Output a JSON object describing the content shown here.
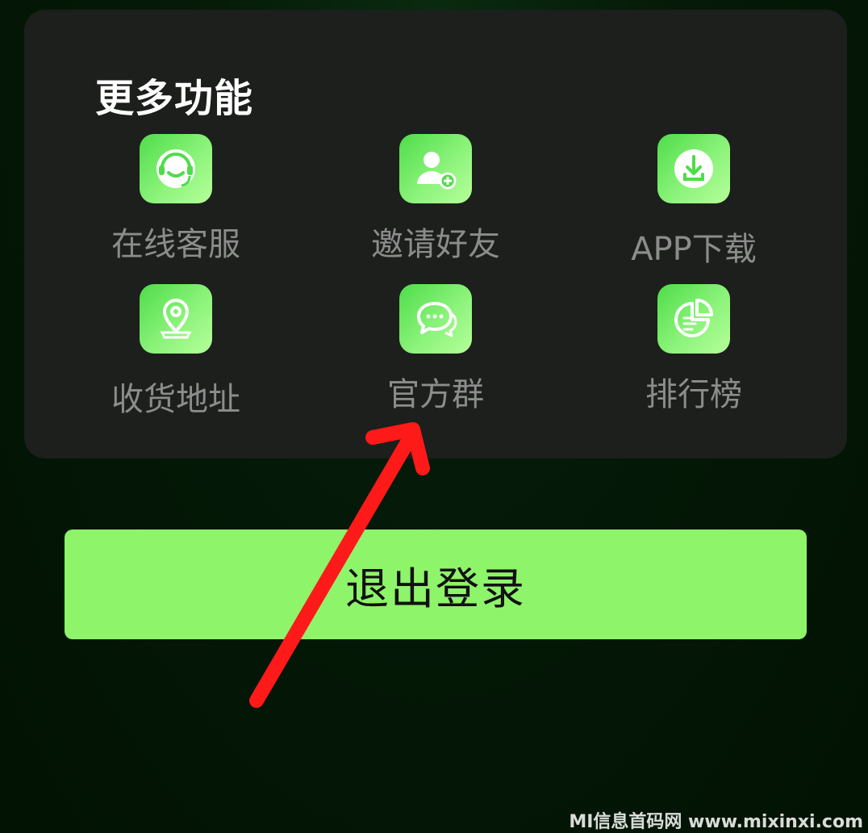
{
  "panel": {
    "title": "更多功能",
    "items": [
      {
        "label": "在线客服",
        "icon": "customer-service-icon"
      },
      {
        "label": "邀请好友",
        "icon": "invite-friend-icon"
      },
      {
        "label": "APP下载",
        "icon": "download-icon"
      },
      {
        "label": "收货地址",
        "icon": "location-pin-icon"
      },
      {
        "label": "官方群",
        "icon": "chat-bubbles-icon"
      },
      {
        "label": "排行榜",
        "icon": "ranking-chart-icon"
      }
    ]
  },
  "logout": {
    "label": "退出登录"
  },
  "watermark": "MI信息首码网 www.mixinxi.com",
  "colors": {
    "background": "#021203",
    "panel": "#1c1f1c",
    "accent_green": "#8ef46a",
    "label_gray": "#8c8c8c",
    "annotation_arrow": "#ff1a1a"
  }
}
